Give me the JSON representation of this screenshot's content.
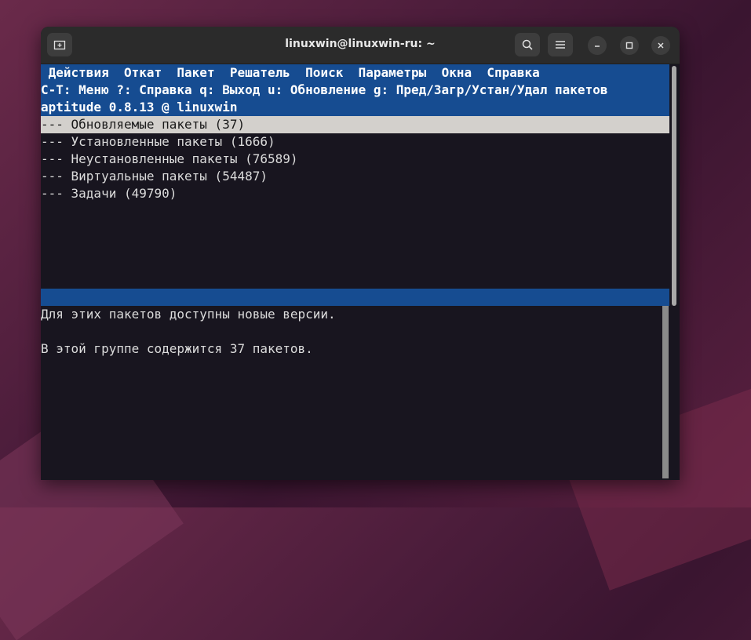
{
  "window": {
    "title": "linuxwin@linuxwin-ru: ~"
  },
  "menu": {
    "items": [
      "Действия",
      "Откат",
      "Пакет",
      "Решатель",
      "Поиск",
      "Параметры",
      "Окна",
      "Справка"
    ]
  },
  "hint_line": "C-T: Меню ?: Справка q: Выход u: Обновление g: Пред/Загр/Устан/Удал пакетов",
  "version_line": "aptitude 0.8.13 @ linuxwin",
  "tree": [
    "--- Обновляемые пакеты (37)",
    "--- Установленные пакеты (1666)",
    "--- Неустановленные пакеты (76589)",
    "--- Виртуальные пакеты (54487)",
    "--- Задачи (49790)"
  ],
  "info": {
    "line1": "Для этих пакетов доступны новые версии.",
    "line2": "В этой группе содержится 37 пакетов."
  },
  "icons": {
    "new_tab": "new-tab-icon",
    "search": "search-icon",
    "menu": "hamburger-icon",
    "minimize": "minimize-icon",
    "maximize": "maximize-icon",
    "close": "close-icon"
  }
}
